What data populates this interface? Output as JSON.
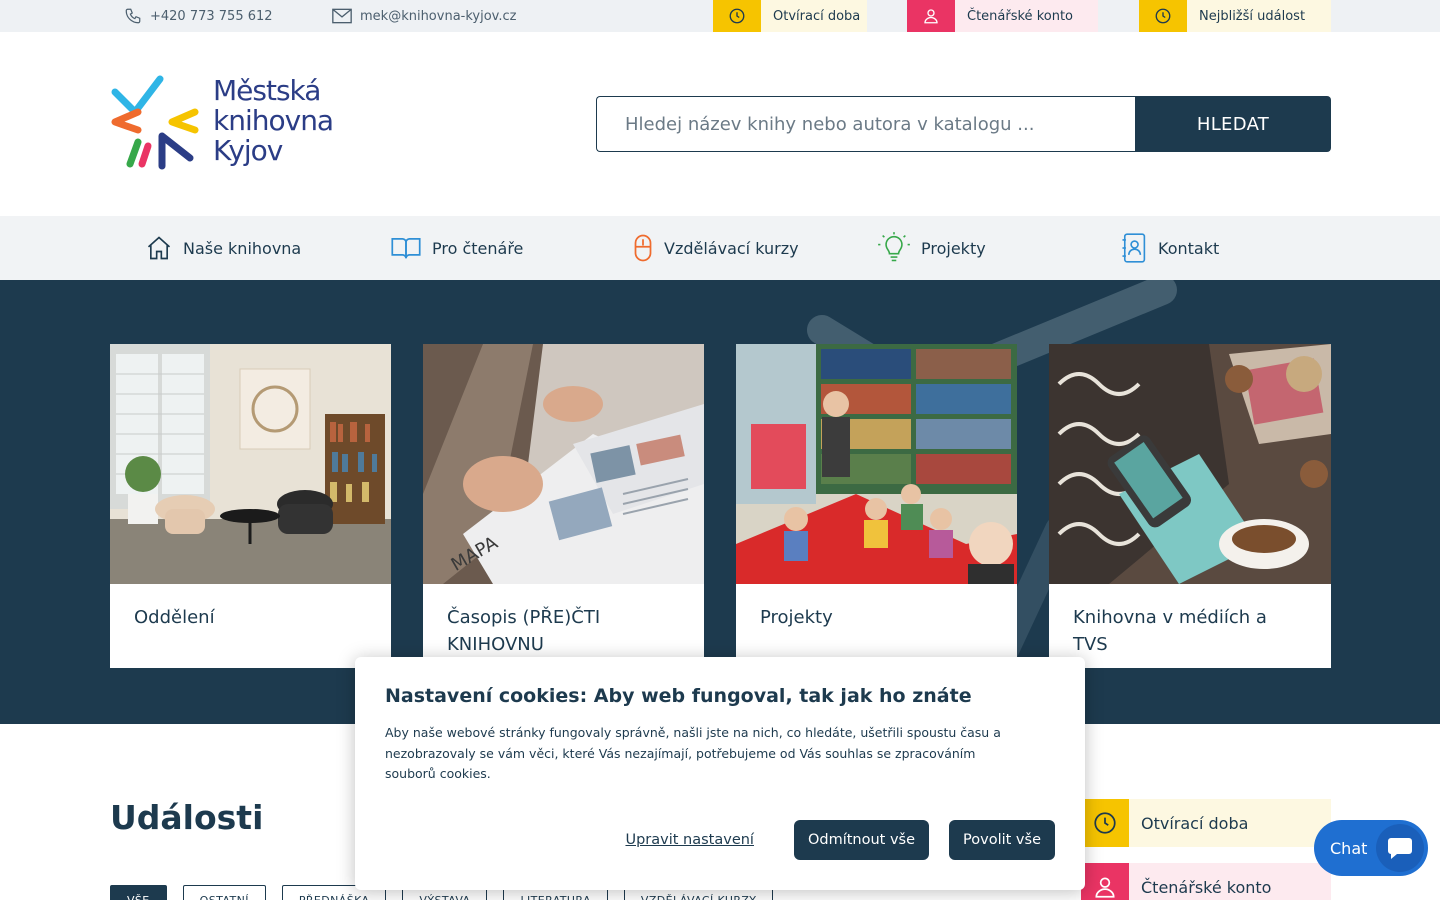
{
  "topbar": {
    "phone": "+420 773 755 612",
    "email": "mek@knihovna-kyjov.cz",
    "quick": [
      {
        "label": "Otvírací doba",
        "icon": "clock-icon",
        "color": "#f6c400",
        "bg": "#fdf8e1"
      },
      {
        "label": "Čtenářské konto",
        "icon": "user-icon",
        "color": "#ea3464",
        "bg": "#fdeaef"
      },
      {
        "label": "Nejbližší událost",
        "icon": "clock-icon",
        "color": "#f6c400",
        "bg": "#fdf8e1"
      }
    ]
  },
  "logo": {
    "line1": "Městská",
    "line2": "knihovna",
    "line3": "Kyjov"
  },
  "search": {
    "placeholder": "Hledej název knihy nebo autora v katalogu ...",
    "button": "HLEDAT"
  },
  "nav": [
    {
      "label": "Naše knihovna",
      "icon": "home-icon"
    },
    {
      "label": "Pro čtenáře",
      "icon": "book-icon"
    },
    {
      "label": "Vzdělávací kurzy",
      "icon": "mouse-icon"
    },
    {
      "label": "Projekty",
      "icon": "bulb-icon"
    },
    {
      "label": "Kontakt",
      "icon": "contact-icon"
    }
  ],
  "cards": [
    {
      "label": "Oddělení"
    },
    {
      "label": "Časopis (PŘE)ČTI KNIHOVNU"
    },
    {
      "label": "Projekty"
    },
    {
      "label": "Knihovna v médiích a TVS"
    }
  ],
  "events": {
    "title": "Události",
    "filters": [
      "VŠE",
      "OSTATNÍ",
      "PŘEDNÁŠKA",
      "VÝSTAVA",
      "LITERATURA",
      "VZDĚLÁVACÍ KURZY"
    ]
  },
  "side_quick": [
    {
      "label": "Otvírací doba",
      "icon": "clock-icon"
    },
    {
      "label": "Čtenářské konto",
      "icon": "user-icon"
    }
  ],
  "cookie": {
    "title": "Nastavení cookies: Aby web fungoval, tak jak ho znáte",
    "text": "Aby naše webové stránky fungovaly správně, našli jste na nich, co hledáte, ušetřili spoustu času a nezobrazovaly se vám věci, které Vás nezajímají, potřebujeme od Vás souhlas se zpracováním souborů cookies.",
    "settings_link": "Upravit nastavení",
    "reject": "Odmítnout vše",
    "accept": "Povolit vše"
  },
  "chat": {
    "label": "Chat"
  },
  "colors": {
    "primary": "#1d3a4e",
    "yellow": "#f6c400",
    "pink": "#ea3464",
    "chat": "#1f6fd1"
  }
}
